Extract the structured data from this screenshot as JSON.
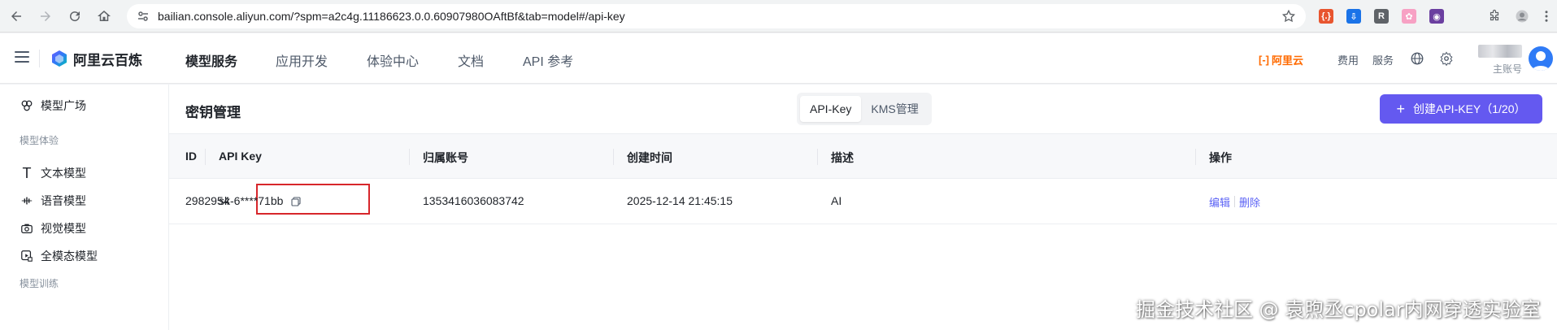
{
  "browser": {
    "url": "bailian.console.aliyun.com/?spm=a2c4g.11186623.0.0.60907980OAftBf&tab=model#/api-key",
    "extensions": [
      {
        "name": "ext-red-icon",
        "glyph": "{.}",
        "color": "#e8552f"
      },
      {
        "name": "ext-download-icon",
        "glyph": "⇩",
        "color": "#1a73e8"
      },
      {
        "name": "ext-r-icon",
        "glyph": "R",
        "color": "#5f6368"
      },
      {
        "name": "ext-pink-icon",
        "glyph": "✿",
        "color": "#f7a1c4"
      },
      {
        "name": "ext-purple-icon",
        "glyph": "◉",
        "color": "#6b3fa0"
      }
    ]
  },
  "header": {
    "logo_text": "阿里云百炼",
    "nav": [
      "模型服务",
      "应用开发",
      "体验中心",
      "文档",
      "API 参考"
    ],
    "brand": "阿里云",
    "links": {
      "billing": "费用",
      "service": "服务"
    },
    "account_label": "主账号"
  },
  "sidebar": {
    "items": [
      {
        "label": "模型广场",
        "icon": "model-square-icon"
      },
      {
        "label": "文本模型",
        "icon": "text-icon"
      },
      {
        "label": "语音模型",
        "icon": "audio-icon"
      },
      {
        "label": "视觉模型",
        "icon": "camera-icon"
      },
      {
        "label": "全模态模型",
        "icon": "omni-icon"
      }
    ],
    "groups": [
      "模型体验",
      "模型训练"
    ]
  },
  "main": {
    "title": "密钥管理",
    "tabs": [
      {
        "label": "API-Key",
        "active": true
      },
      {
        "label": "KMS管理",
        "active": false
      }
    ],
    "create_button": "创建API-KEY（1/20）",
    "columns": [
      "ID",
      "API Key",
      "归属账号",
      "创建时间",
      "描述",
      "操作"
    ],
    "rows": [
      {
        "id": "2982954",
        "api_key": "sk-6****71bb",
        "account": "1353416036083742",
        "created": "2025-12-14 21:45:15",
        "desc": "AI",
        "actions": [
          "编辑",
          "删除"
        ]
      }
    ]
  },
  "watermark": "掘金技术社区 @ 袁煦丞cpolar内网穿透实验室",
  "colors": {
    "accent": "#6459f0",
    "link": "#5b62f5",
    "highlight": "#d7262b",
    "brand": "#ff6a00"
  }
}
